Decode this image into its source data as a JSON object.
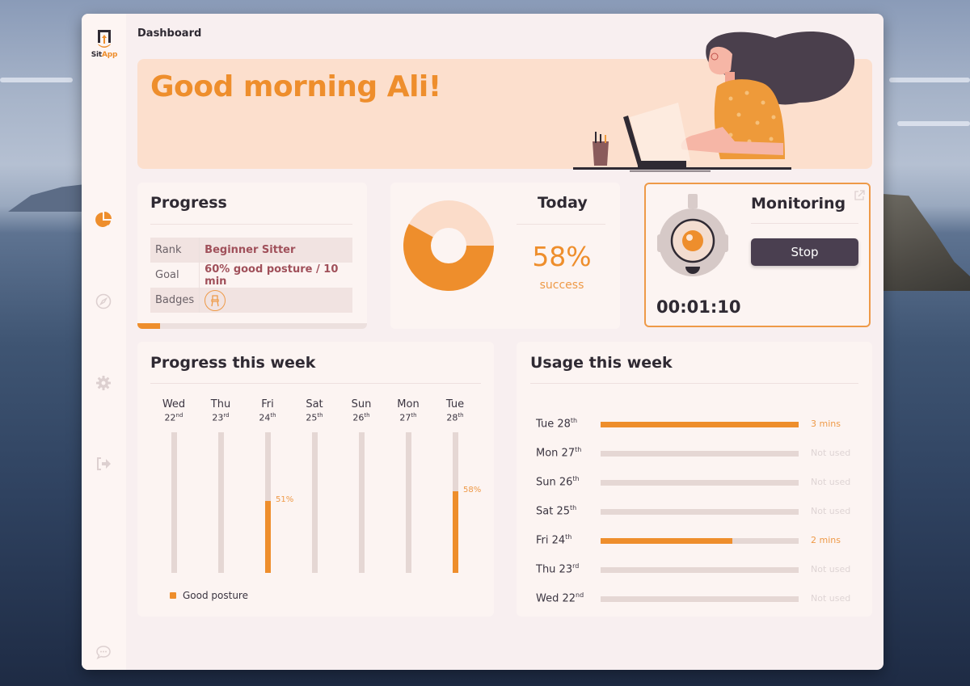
{
  "app": {
    "logo_sit": "Sit",
    "logo_app": "App",
    "page_title": "Dashboard",
    "accent_color": "#ee8e2c"
  },
  "sidebar": {
    "items": [
      {
        "name": "dashboard",
        "icon": "pie-chart-icon",
        "active": true
      },
      {
        "name": "explore",
        "icon": "compass-icon",
        "active": false
      },
      {
        "name": "settings",
        "icon": "gear-icon",
        "active": false
      },
      {
        "name": "logout",
        "icon": "logout-icon",
        "active": false
      }
    ],
    "bottom_icon": "chat-icon"
  },
  "banner": {
    "greeting": "Good morning Ali!"
  },
  "progress": {
    "title": "Progress",
    "rows": [
      {
        "label": "Rank",
        "value": "Beginner Sitter"
      },
      {
        "label": "Goal",
        "value": "60% good posture / 10 min"
      },
      {
        "label": "Badges",
        "value": ""
      }
    ],
    "badge_icon": "chair-badge-icon",
    "bar_fraction": 0.1
  },
  "today": {
    "title": "Today",
    "value": "58%",
    "sub": "success",
    "success_fraction": 0.58
  },
  "monitoring": {
    "title": "Monitoring",
    "button_label": "Stop",
    "timer": "00:01:10"
  },
  "week": {
    "title": "Progress this week",
    "legend": "Good posture",
    "days": [
      {
        "name": "Wed",
        "date": "22",
        "suffix": "nd",
        "value": null,
        "label": ""
      },
      {
        "name": "Thu",
        "date": "23",
        "suffix": "rd",
        "value": null,
        "label": ""
      },
      {
        "name": "Fri",
        "date": "24",
        "suffix": "th",
        "value": 51,
        "label": "51%"
      },
      {
        "name": "Sat",
        "date": "25",
        "suffix": "th",
        "value": null,
        "label": ""
      },
      {
        "name": "Sun",
        "date": "26",
        "suffix": "th",
        "value": null,
        "label": ""
      },
      {
        "name": "Mon",
        "date": "27",
        "suffix": "th",
        "value": null,
        "label": ""
      },
      {
        "name": "Tue",
        "date": "28",
        "suffix": "th",
        "value": 58,
        "label": "58%"
      }
    ]
  },
  "usage": {
    "title": "Usage this week",
    "max_minutes": 3,
    "rows": [
      {
        "day": "Tue 28",
        "suffix": "th",
        "minutes": 3,
        "label": "3 mins"
      },
      {
        "day": "Mon 27",
        "suffix": "th",
        "minutes": 0,
        "label": "Not used"
      },
      {
        "day": "Sun 26",
        "suffix": "th",
        "minutes": 0,
        "label": "Not used"
      },
      {
        "day": "Sat 25",
        "suffix": "th",
        "minutes": 0,
        "label": "Not used"
      },
      {
        "day": "Fri 24",
        "suffix": "th",
        "minutes": 2,
        "label": "2 mins"
      },
      {
        "day": "Thu 23",
        "suffix": "rd",
        "minutes": 0,
        "label": "Not used"
      },
      {
        "day": "Wed 22",
        "suffix": "nd",
        "minutes": 0,
        "label": "Not used"
      }
    ]
  }
}
